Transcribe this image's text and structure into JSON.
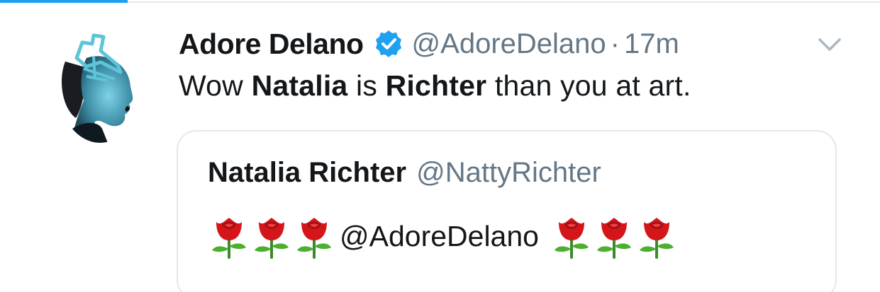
{
  "tweet": {
    "author": {
      "display_name": "Adore Delano",
      "handle": "@AdoreDelano",
      "verified": true
    },
    "separator": "·",
    "time": "17m",
    "text": {
      "t1": "Wow ",
      "b1": "Natalia",
      "t2": " is ",
      "b2": "Richter",
      "t3": " than you at art."
    }
  },
  "quoted_tweet": {
    "display_name": "Natalia Richter",
    "handle": "@NattyRichter",
    "emoji_before_count": 3,
    "mention": "@AdoreDelano",
    "emoji_after_count": 3,
    "emoji": "rose"
  },
  "colors": {
    "accent": "#1da1f2",
    "text": "#14171a",
    "secondary": "#657786",
    "border": "#e1e8ed"
  },
  "icons": {
    "verified": "verified-badge-icon",
    "caret": "chevron-down-icon",
    "emoji": "rose-emoji-icon"
  }
}
